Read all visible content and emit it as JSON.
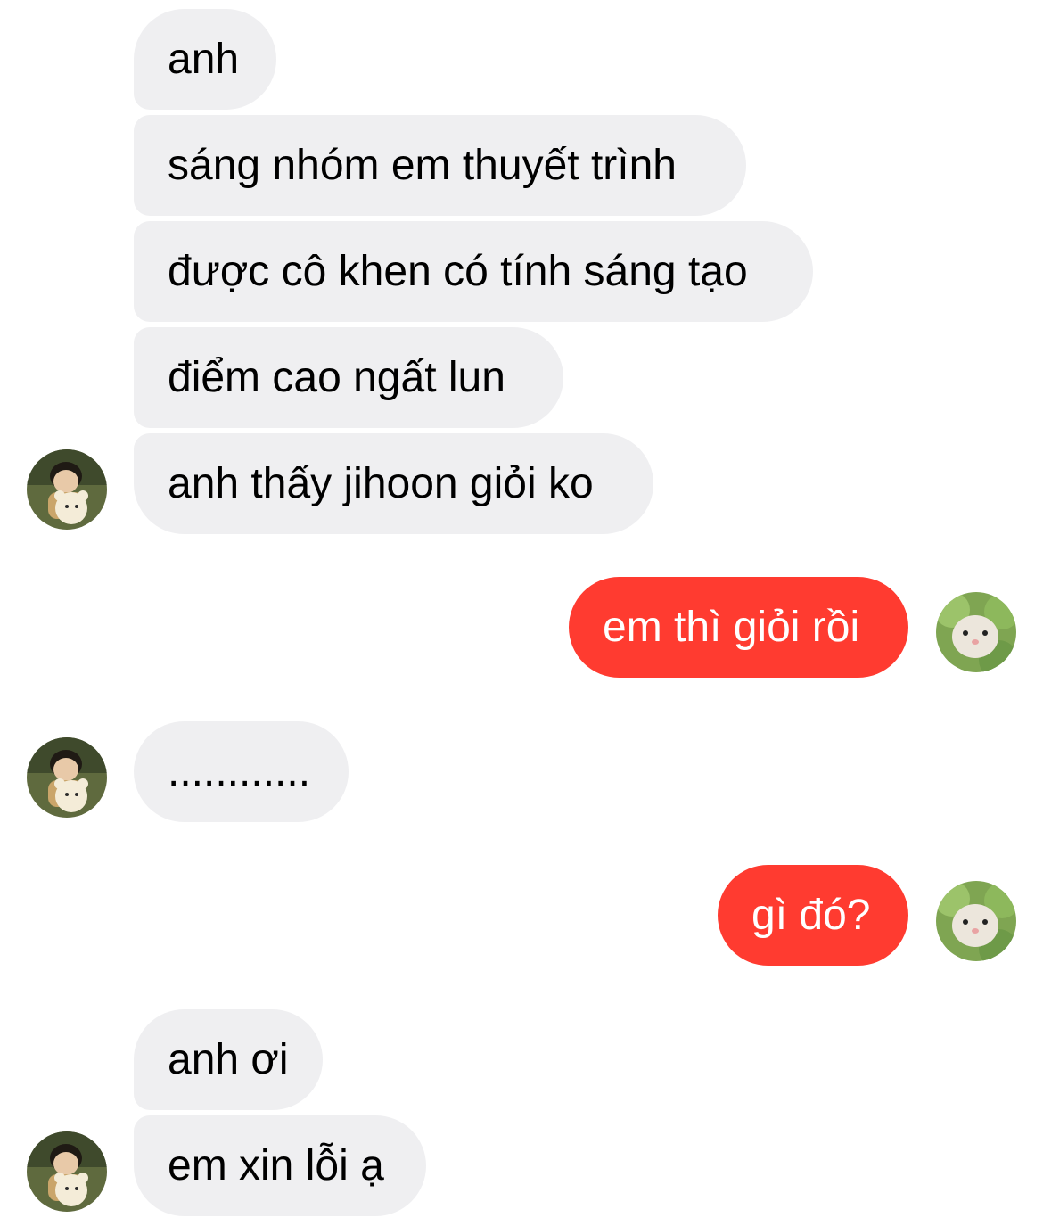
{
  "conversation": {
    "incoming_group_1": [
      "anh",
      "sáng nhóm em thuyết trình",
      "được cô khen có tính sáng tạo",
      "điểm cao ngất lun",
      "anh thấy jihoon giỏi ko"
    ],
    "outgoing_1": "em thì giỏi rồi",
    "incoming_2": "............",
    "outgoing_2": "gì đó?",
    "incoming_group_3": [
      "anh ơi",
      "em xin lỗi ạ"
    ]
  },
  "avatars": {
    "contact": "boy-with-teddy-bear-avatar",
    "self": "hamster-avatar"
  },
  "colors": {
    "incoming_bubble": "#efeff1",
    "outgoing_bubble": "#ff3b30",
    "incoming_text": "#000000",
    "outgoing_text": "#ffffff"
  }
}
